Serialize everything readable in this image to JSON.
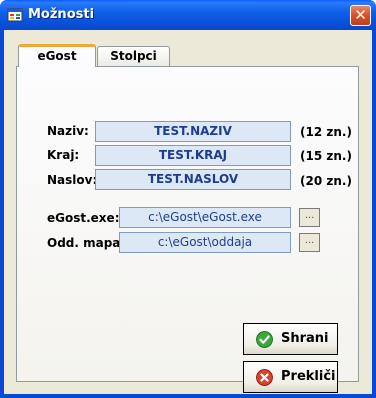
{
  "window": {
    "title": "Možnosti"
  },
  "tabs": [
    {
      "label": "eGost"
    },
    {
      "label": "Stolpci"
    }
  ],
  "fields": {
    "naziv": {
      "label": "Naziv:",
      "value": "TEST.NAZIV",
      "hint": "(12 zn.)"
    },
    "kraj": {
      "label": "Kraj:",
      "value": "TEST.KRAJ",
      "hint": "(15 zn.)"
    },
    "naslov": {
      "label": "Naslov:",
      "value": "TEST.NASLOV",
      "hint": "(20 zn.)"
    },
    "exe": {
      "label": "eGost.exe:",
      "value": "c:\\eGost\\eGost.exe",
      "browse": "..."
    },
    "mapa": {
      "label": "Odd. mapa:",
      "value": "c:\\eGost\\oddaja",
      "browse": "..."
    }
  },
  "buttons": {
    "save": {
      "label": "Shrani",
      "icon": "check-icon"
    },
    "cancel": {
      "label": "Prekliči",
      "icon": "cancel-icon"
    }
  },
  "colors": {
    "titlebar": "#0a4fd8",
    "field_bg": "#dde8f7",
    "field_text": "#1f3d8a",
    "tab_accent": "#f0a838"
  }
}
